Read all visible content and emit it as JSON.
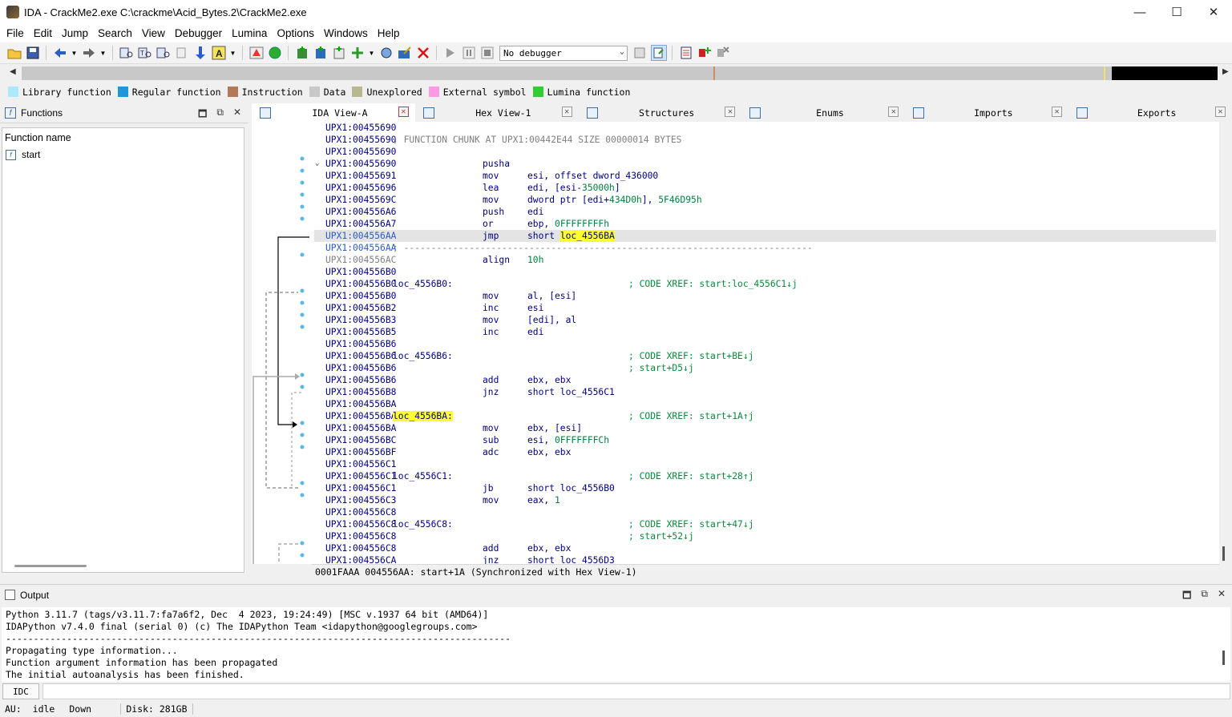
{
  "window": {
    "title": "IDA - CrackMe2.exe C:\\crackme\\Acid_Bytes.2\\CrackMe2.exe",
    "minimize": "—",
    "maximize": "☐",
    "close": "✕"
  },
  "menu": [
    "File",
    "Edit",
    "Jump",
    "Search",
    "View",
    "Debugger",
    "Lumina",
    "Options",
    "Windows",
    "Help"
  ],
  "toolbar": {
    "debugger_select": "No debugger"
  },
  "legend": [
    {
      "label": "Library function",
      "color": "#aee8ff"
    },
    {
      "label": "Regular function",
      "color": "#1e96d8"
    },
    {
      "label": "Instruction",
      "color": "#b07a5a"
    },
    {
      "label": "Data",
      "color": "#c8c8c8"
    },
    {
      "label": "Unexplored",
      "color": "#b8b890"
    },
    {
      "label": "External symbol",
      "color": "#ff99e6"
    },
    {
      "label": "Lumina function",
      "color": "#33cc33"
    }
  ],
  "functions_panel": {
    "title": "Functions",
    "column_header": "Function name",
    "items": [
      "start"
    ]
  },
  "tabs": [
    {
      "label": "IDA View-A",
      "active": true
    },
    {
      "label": "Hex View-1",
      "active": false
    },
    {
      "label": "Structures",
      "active": false
    },
    {
      "label": "Enums",
      "active": false
    },
    {
      "label": "Imports",
      "active": false
    },
    {
      "label": "Exports",
      "active": false
    }
  ],
  "disasm": {
    "lines": [
      {
        "addr": "UPX1:00455690",
        "text": ""
      },
      {
        "addr": "UPX1:00455690",
        "text": "; FUNCTION CHUNK AT UPX1:00442E44 SIZE 00000014 BYTES",
        "kind": "chunk"
      },
      {
        "addr": "UPX1:00455690",
        "text": ""
      },
      {
        "addr": "UPX1:00455690",
        "mn": "pusha",
        "ops": "",
        "collapse": true
      },
      {
        "addr": "UPX1:00455691",
        "mn": "mov",
        "ops": "esi, offset dword_436000"
      },
      {
        "addr": "UPX1:00455696",
        "mn": "lea",
        "ops": "edi, [esi-",
        "num": "35000h",
        "ops2": "]"
      },
      {
        "addr": "UPX1:0045569C",
        "mn": "mov",
        "ops": "dword ptr [edi+",
        "num": "434D0h",
        "ops2": "], ",
        "num2": "5F46D95h"
      },
      {
        "addr": "UPX1:004556A6",
        "mn": "push",
        "ops": "edi"
      },
      {
        "addr": "UPX1:004556A7",
        "mn": "or",
        "ops": "ebp, ",
        "num": "0FFFFFFFFh"
      },
      {
        "addr": "UPX1:004556AA",
        "mn": "jmp",
        "ops": "short ",
        "hl": "loc_4556BA",
        "selected": true
      },
      {
        "addr": "UPX1:004556AA",
        "text": "; ---------------------------------------------------------------------------",
        "kind": "sep",
        "gray": true
      },
      {
        "addr": "UPX1:004556AC",
        "mn": "align",
        "num": "10h",
        "gray": true
      },
      {
        "addr": "UPX1:004556B0",
        "text": ""
      },
      {
        "addr": "UPX1:004556B0",
        "label": "loc_4556B0:",
        "xref": "; CODE XREF: start:loc_4556C1↓j"
      },
      {
        "addr": "UPX1:004556B0",
        "mn": "mov",
        "ops": "al, [esi]"
      },
      {
        "addr": "UPX1:004556B2",
        "mn": "inc",
        "ops": "esi"
      },
      {
        "addr": "UPX1:004556B3",
        "mn": "mov",
        "ops": "[edi], al"
      },
      {
        "addr": "UPX1:004556B5",
        "mn": "inc",
        "ops": "edi"
      },
      {
        "addr": "UPX1:004556B6",
        "text": ""
      },
      {
        "addr": "UPX1:004556B6",
        "label": "loc_4556B6:",
        "xref": "; CODE XREF: start+BE↓j"
      },
      {
        "addr": "UPX1:004556B6",
        "xref": "; start+D5↓j"
      },
      {
        "addr": "UPX1:004556B6",
        "mn": "add",
        "ops": "ebx, ebx"
      },
      {
        "addr": "UPX1:004556B8",
        "mn": "jnz",
        "ops": "short loc_4556C1"
      },
      {
        "addr": "UPX1:004556BA",
        "text": ""
      },
      {
        "addr": "UPX1:004556BA",
        "label": "loc_4556BA:",
        "label_hl": true,
        "xref": "; CODE XREF: start+1A↑j"
      },
      {
        "addr": "UPX1:004556BA",
        "mn": "mov",
        "ops": "ebx, [esi]"
      },
      {
        "addr": "UPX1:004556BC",
        "mn": "sub",
        "ops": "esi, ",
        "num": "0FFFFFFFCh"
      },
      {
        "addr": "UPX1:004556BF",
        "mn": "adc",
        "ops": "ebx, ebx"
      },
      {
        "addr": "UPX1:004556C1",
        "text": ""
      },
      {
        "addr": "UPX1:004556C1",
        "label": "loc_4556C1:",
        "xref": "; CODE XREF: start+28↑j"
      },
      {
        "addr": "UPX1:004556C1",
        "mn": "jb",
        "ops": "short loc_4556B0"
      },
      {
        "addr": "UPX1:004556C3",
        "mn": "mov",
        "ops": "eax, ",
        "num": "1"
      },
      {
        "addr": "UPX1:004556C8",
        "text": ""
      },
      {
        "addr": "UPX1:004556C8",
        "label": "loc_4556C8:",
        "xref": "; CODE XREF: start+47↓j"
      },
      {
        "addr": "UPX1:004556C8",
        "xref": "; start+52↓j"
      },
      {
        "addr": "UPX1:004556C8",
        "mn": "add",
        "ops": "ebx, ebx"
      },
      {
        "addr": "UPX1:004556CA",
        "mn": "jnz",
        "ops": "short loc_4556D3"
      }
    ],
    "status": "0001FAAA 004556AA: start+1A (Synchronized with Hex View-1)"
  },
  "output": {
    "title": "Output",
    "lines": [
      "Python 3.11.7 (tags/v3.11.7:fa7a6f2, Dec  4 2023, 19:24:49) [MSC v.1937 64 bit (AMD64)]",
      "IDAPython v7.4.0 final (serial 0) (c) The IDAPython Team <idapython@googlegroups.com>",
      "-------------------------------------------------------------------------------------------",
      "Propagating type information...",
      "Function argument information has been propagated",
      "The initial autoanalysis has been finished."
    ]
  },
  "cmdline": {
    "lang": "IDC"
  },
  "status": {
    "au_label": "AU:",
    "au_state": "idle",
    "direction": "Down",
    "disk": "Disk: 281GB"
  }
}
